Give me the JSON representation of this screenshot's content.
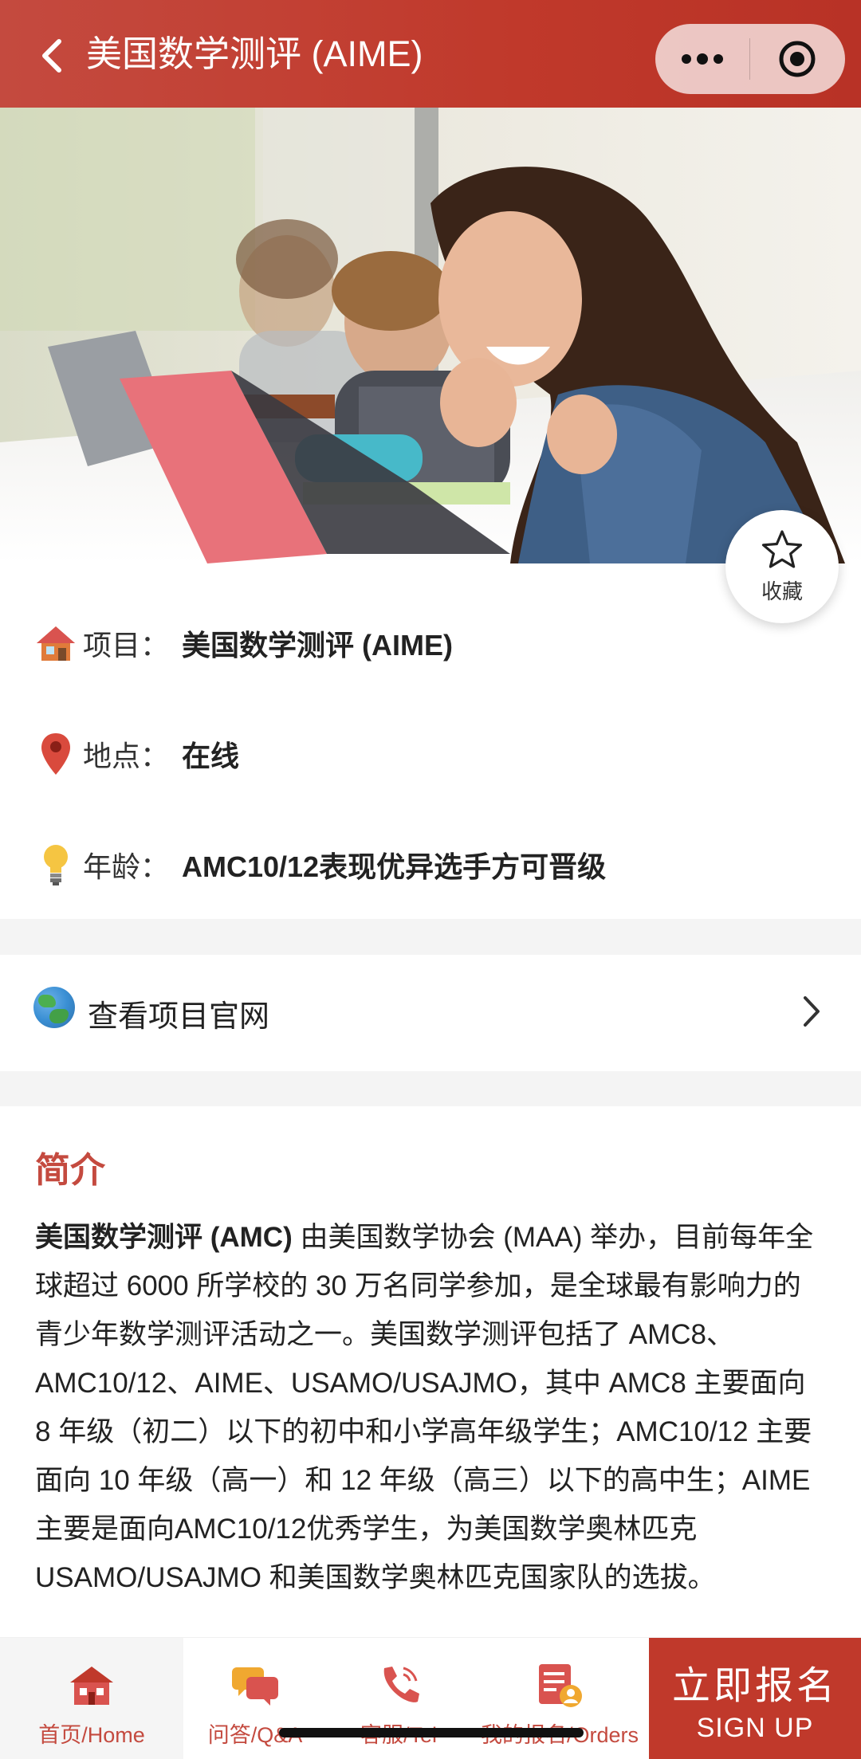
{
  "header": {
    "title": "美国数学测评 (AIME)",
    "back_icon": "chevron-left-icon",
    "more_icon": "more-dots-icon",
    "close_icon": "target-icon"
  },
  "hero": {
    "image": "students-celebrating-photo"
  },
  "favorite": {
    "label": "收藏",
    "icon": "star-icon"
  },
  "info": [
    {
      "icon": "house-icon",
      "key": "项目：",
      "value": "美国数学测评 (AIME)"
    },
    {
      "icon": "location-pin-icon",
      "key": "地点：",
      "value": "在线"
    },
    {
      "icon": "lightbulb-icon",
      "key": "年龄：",
      "value": "AMC10/12表现优异选手方可晋级"
    }
  ],
  "website": {
    "label": "查看项目官网",
    "icon": "globe-icon"
  },
  "intro": {
    "title": "简介",
    "bold_lead": "美国数学测评 (AMC)",
    "body": " 由美国数学协会 (MAA) 举办，目前每年全球超过 6000 所学校的 30 万名同学参加，是全球最有影响力的青少年数学测评活动之一。美国数学测评包括了 AMC8、AMC10/12、AIME、USAMO/USAJMO，其中 AMC8 主要面向 8 年级（初二）以下的初中和小学高年级学生；AMC10/12 主要面向 10 年级（高一）和 12 年级（高三）以下的高中生；AIME 主要是面向AMC10/12优秀学生，为美国数学奥林匹克 USAMO/USAJMO 和美国数学奥林匹克国家队的选拔。"
  },
  "tabbar": {
    "tabs": [
      {
        "label": "首页/Home",
        "icon": "home-icon"
      },
      {
        "label": "问答/Q&A",
        "icon": "chat-bubbles-icon"
      },
      {
        "label": "客服/Tel",
        "icon": "phone-icon"
      },
      {
        "label": "我的报名/Orders",
        "icon": "orders-icon"
      }
    ],
    "signup_cn": "立即报名",
    "signup_en": "SIGN UP"
  },
  "colors": {
    "brand": "#c0392b",
    "accent_text": "#c44a3f"
  }
}
